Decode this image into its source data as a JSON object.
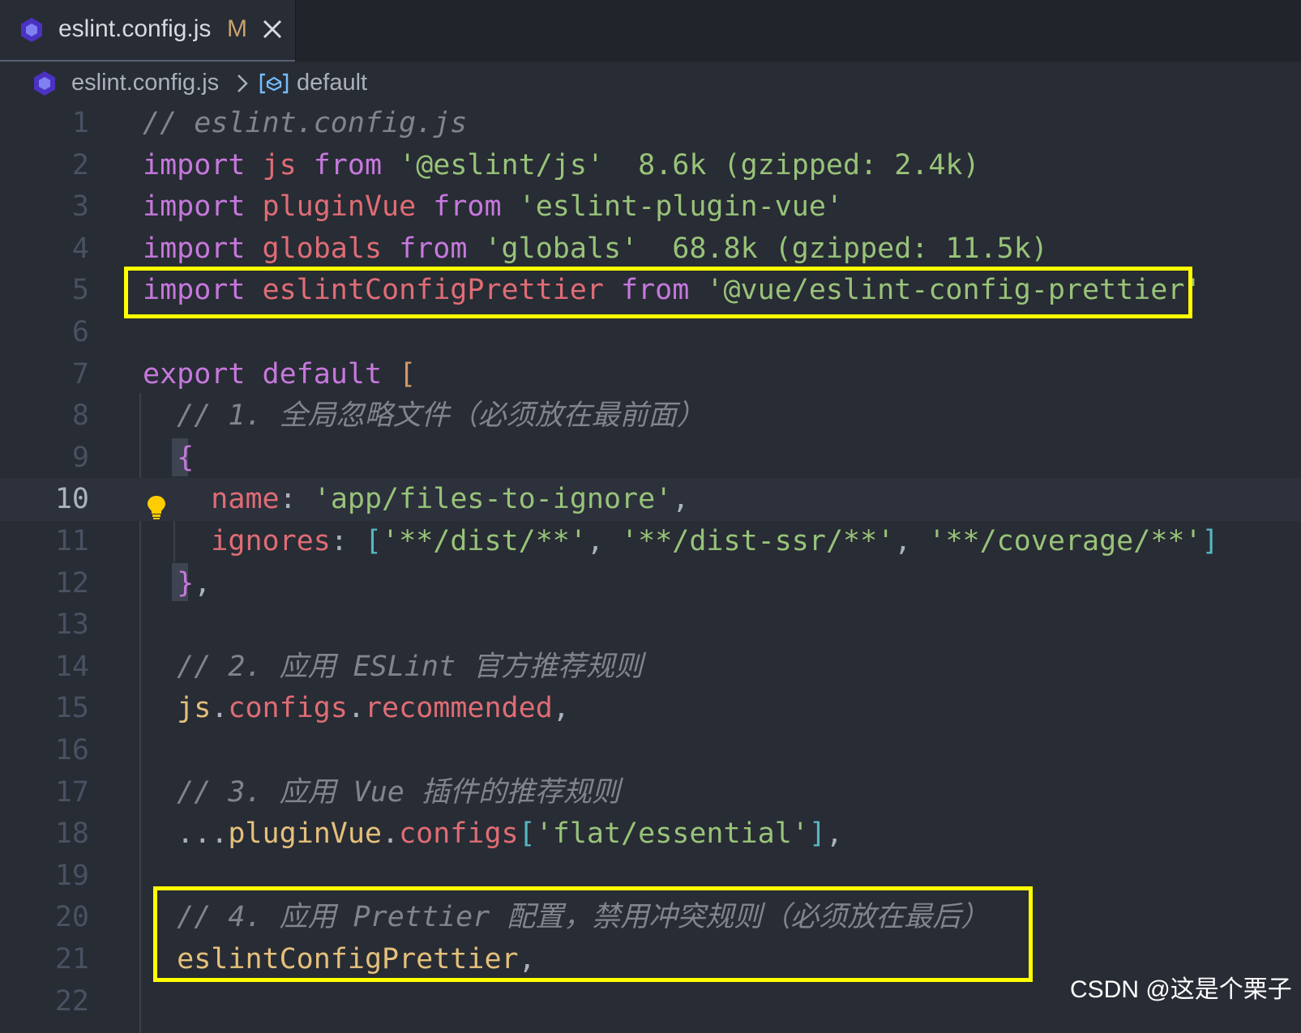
{
  "tab": {
    "title": "eslint.config.js",
    "status": "M",
    "icon": "eslint-icon",
    "close_icon": "close-icon"
  },
  "breadcrumb": {
    "file": "eslint.config.js",
    "separator_icon": "chevron-right-icon",
    "symbol_icon": "symbol-variable-icon",
    "symbol": "default"
  },
  "editor": {
    "active_line": 10,
    "lines": [
      {
        "n": "1",
        "tokens": [
          [
            "// eslint.config.js",
            "cm"
          ]
        ]
      },
      {
        "n": "2",
        "tokens": [
          [
            "import",
            "kw"
          ],
          [
            " ",
            "plain"
          ],
          [
            "js",
            "var"
          ],
          [
            " ",
            "plain"
          ],
          [
            "from",
            "kw"
          ],
          [
            " ",
            "plain"
          ],
          [
            "'@eslint/js'",
            "str"
          ],
          [
            "  8.6k (gzipped: 2.4k)",
            "size"
          ]
        ]
      },
      {
        "n": "3",
        "tokens": [
          [
            "import",
            "kw"
          ],
          [
            " ",
            "plain"
          ],
          [
            "pluginVue",
            "var"
          ],
          [
            " ",
            "plain"
          ],
          [
            "from",
            "kw"
          ],
          [
            " ",
            "plain"
          ],
          [
            "'eslint-plugin-vue'",
            "str"
          ]
        ]
      },
      {
        "n": "4",
        "tokens": [
          [
            "import",
            "kw"
          ],
          [
            " ",
            "plain"
          ],
          [
            "globals",
            "var"
          ],
          [
            " ",
            "plain"
          ],
          [
            "from",
            "kw"
          ],
          [
            " ",
            "plain"
          ],
          [
            "'globals'",
            "str"
          ],
          [
            "  68.8k (gzipped: 11.5k)",
            "size"
          ]
        ]
      },
      {
        "n": "5",
        "tokens": [
          [
            "import",
            "kw"
          ],
          [
            " ",
            "plain"
          ],
          [
            "eslintConfigPrettier",
            "var"
          ],
          [
            " ",
            "plain"
          ],
          [
            "from",
            "kw"
          ],
          [
            " ",
            "plain"
          ],
          [
            "'@vue/eslint-config-prettier'",
            "str"
          ]
        ]
      },
      {
        "n": "6",
        "tokens": []
      },
      {
        "n": "7",
        "tokens": [
          [
            "export",
            "kw"
          ],
          [
            " ",
            "plain"
          ],
          [
            "default",
            "kw"
          ],
          [
            " ",
            "plain"
          ],
          [
            "[",
            "br1"
          ]
        ]
      },
      {
        "n": "8",
        "tokens": [
          [
            "  // 1. 全局忽略文件（必须放在最前面）",
            "cm"
          ]
        ]
      },
      {
        "n": "9",
        "tokens": [
          [
            "  ",
            "plain"
          ],
          [
            "{",
            "br2"
          ]
        ]
      },
      {
        "n": "10",
        "tokens": [
          [
            "    ",
            "plain"
          ],
          [
            "name",
            "prop"
          ],
          [
            ": ",
            "plain"
          ],
          [
            "'app/files-to-ignore'",
            "str"
          ],
          [
            ",",
            "plain"
          ]
        ]
      },
      {
        "n": "11",
        "tokens": [
          [
            "    ",
            "plain"
          ],
          [
            "ignores",
            "prop"
          ],
          [
            ": ",
            "plain"
          ],
          [
            "[",
            "br3"
          ],
          [
            "'**/dist/**'",
            "str"
          ],
          [
            ", ",
            "plain"
          ],
          [
            "'**/dist-ssr/**'",
            "str"
          ],
          [
            ", ",
            "plain"
          ],
          [
            "'**/coverage/**'",
            "str"
          ],
          [
            "]",
            "br3"
          ]
        ]
      },
      {
        "n": "12",
        "tokens": [
          [
            "  ",
            "plain"
          ],
          [
            "}",
            "br2"
          ],
          [
            ",",
            "plain"
          ]
        ]
      },
      {
        "n": "13",
        "tokens": []
      },
      {
        "n": "14",
        "tokens": [
          [
            "  // 2. 应用 ESLint 官方推荐规则",
            "cm"
          ]
        ]
      },
      {
        "n": "15",
        "tokens": [
          [
            "  ",
            "plain"
          ],
          [
            "js",
            "id"
          ],
          [
            ".",
            "plain"
          ],
          [
            "configs",
            "var"
          ],
          [
            ".",
            "plain"
          ],
          [
            "recommended",
            "var"
          ],
          [
            ",",
            "plain"
          ]
        ]
      },
      {
        "n": "16",
        "tokens": []
      },
      {
        "n": "17",
        "tokens": [
          [
            "  // 3. 应用 Vue 插件的推荐规则",
            "cm"
          ]
        ]
      },
      {
        "n": "18",
        "tokens": [
          [
            "  ...",
            "plain"
          ],
          [
            "pluginVue",
            "id"
          ],
          [
            ".",
            "plain"
          ],
          [
            "configs",
            "var"
          ],
          [
            "[",
            "br3"
          ],
          [
            "'flat/essential'",
            "str"
          ],
          [
            "]",
            "br3"
          ],
          [
            ",",
            "plain"
          ]
        ]
      },
      {
        "n": "19",
        "tokens": []
      },
      {
        "n": "20",
        "tokens": [
          [
            "  // 4. 应用 Prettier 配置，禁用冲突规则（必须放在最后）",
            "cm"
          ]
        ]
      },
      {
        "n": "21",
        "tokens": [
          [
            "  ",
            "plain"
          ],
          [
            "eslintConfigPrettier",
            "id"
          ],
          [
            ",",
            "plain"
          ]
        ]
      },
      {
        "n": "22",
        "tokens": []
      }
    ]
  },
  "lightbulb_icon": "lightbulb-icon",
  "watermark": "CSDN @这是个栗子",
  "colors": {
    "highlight_box": "#ffff00",
    "editor_bg": "#282c34",
    "keyword": "#c678dd",
    "variable": "#e06c75",
    "string": "#98c379",
    "comment": "#7f848e"
  }
}
